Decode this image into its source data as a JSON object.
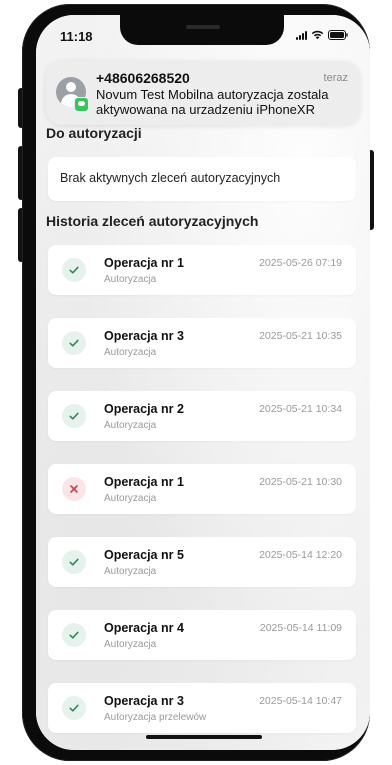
{
  "status_bar": {
    "time": "11:18"
  },
  "notification": {
    "sender": "+48606268520",
    "time": "teraz",
    "message": "Novum Test Mobilna autoryzacja zostala aktywowana na urzadzeniu iPhoneXR",
    "avatar_icon": "contact-avatar-icon",
    "badge_icon": "messages-app-icon"
  },
  "sections": {
    "pending_title": "Do autoryzacji",
    "pending_empty": "Brak aktywnych zleceń autoryzacyjnych",
    "history_title": "Historia zleceń autoryzacyjnych"
  },
  "history": [
    {
      "title": "Operacja nr 1",
      "subtitle": "Autoryzacja",
      "date": "2025-05-26 07:19",
      "status": "success"
    },
    {
      "title": "Operacja nr 3",
      "subtitle": "Autoryzacja",
      "date": "2025-05-21 10:35",
      "status": "success"
    },
    {
      "title": "Operacja nr 2",
      "subtitle": "Autoryzacja",
      "date": "2025-05-21 10:34",
      "status": "success"
    },
    {
      "title": "Operacja nr 1",
      "subtitle": "Autoryzacja",
      "date": "2025-05-21 10:30",
      "status": "rejected"
    },
    {
      "title": "Operacja nr 5",
      "subtitle": "Autoryzacja",
      "date": "2025-05-14 12:20",
      "status": "success"
    },
    {
      "title": "Operacja nr 4",
      "subtitle": "Autoryzacja",
      "date": "2025-05-14 11:09",
      "status": "success"
    },
    {
      "title": "Operacja nr 3",
      "subtitle": "Autoryzacja przelewów",
      "date": "2025-05-14 10:47",
      "status": "success"
    }
  ],
  "colors": {
    "success": "#2e8b57",
    "rejected": "#d23c4a"
  }
}
